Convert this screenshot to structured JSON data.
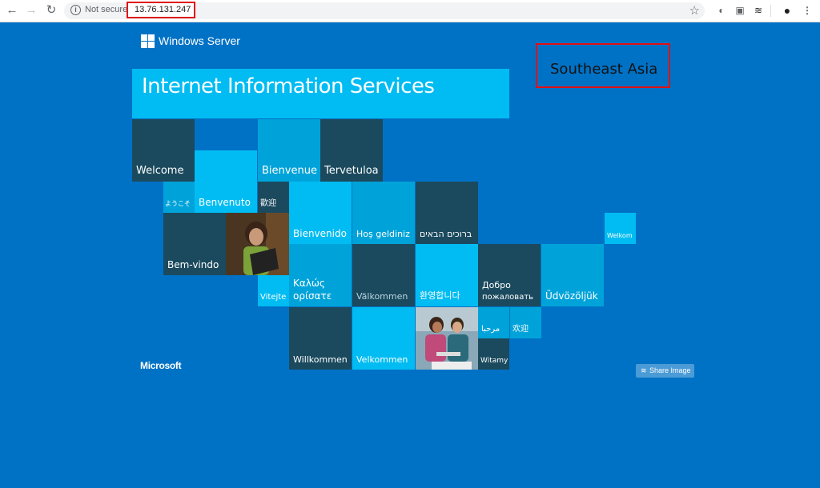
{
  "browser": {
    "security_label": "Not secure",
    "url": "13.76.131.247"
  },
  "page": {
    "brand": "Windows Server",
    "title": "Internet Information Services",
    "region_label": "Southeast Asia",
    "footer_brand": "Microsoft",
    "share_button": "Share Image",
    "tiles": {
      "welcome": "Welcome",
      "bienvenue": "Bienvenue",
      "tervetuloa": "Tervetuloa",
      "youkoso": "ようこそ",
      "benvenuto": "Benvenuto",
      "huanying_trad": "歡迎",
      "bienvenido": "Bienvenido",
      "hos_geldiniz": "Hoş geldiniz",
      "hebrew": "ברוכים הבאים",
      "welkom": "Welkom",
      "bem_vindo": "Bem-vindo",
      "vitejte": "Vitejte",
      "kalos_1": "Καλώς",
      "kalos_2": "ορίσατε",
      "valkommen": "Välkommen",
      "korean": "환영합니다",
      "dobro_1": "Добро",
      "dobro_2": "пожаловать",
      "udvozoljuk": "Üdvözöljük",
      "arabic": "مرحبا",
      "huanying_simp": "欢迎",
      "willkommen": "Willkommen",
      "velkommen": "Velkommen",
      "witamy": "Witamy"
    }
  }
}
